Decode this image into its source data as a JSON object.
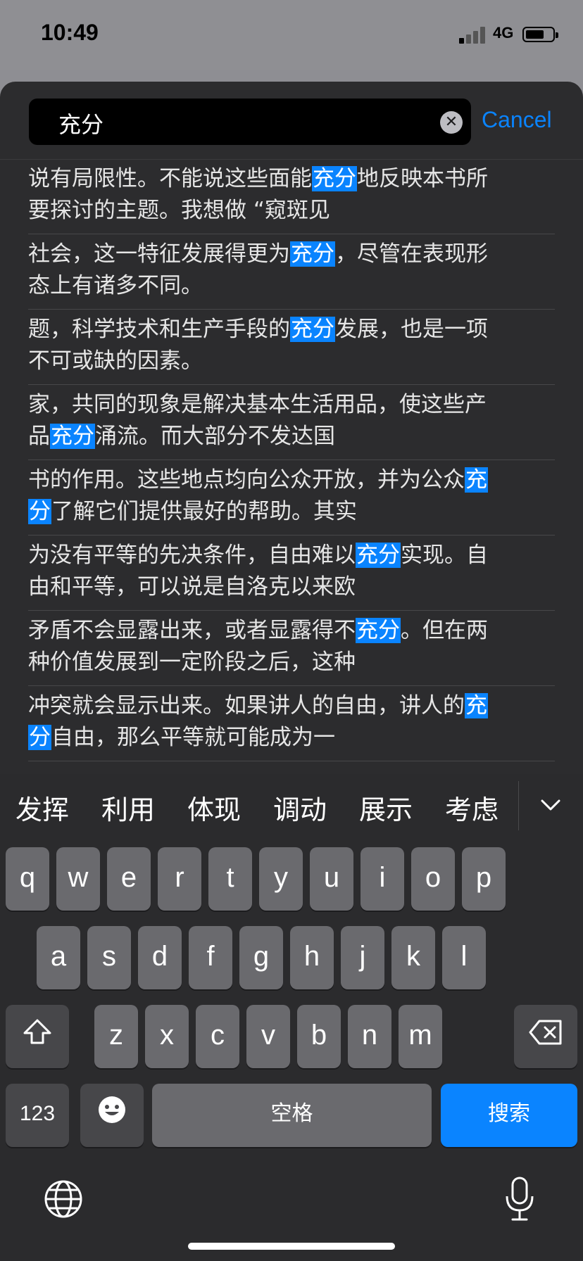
{
  "status": {
    "time": "10:49",
    "network": "4G"
  },
  "search": {
    "query": "充分",
    "cancel_label": "Cancel"
  },
  "results": [
    {
      "lines": [
        [
          [
            "说有局限性。不能说这些面能",
            false
          ],
          [
            "充分",
            true
          ],
          [
            "地反映本书所",
            false
          ]
        ],
        [
          [
            "要探讨的主题。我想做 “窥斑见",
            false
          ]
        ]
      ]
    },
    {
      "lines": [
        [
          [
            "社会，这一特征发展得更为",
            false
          ],
          [
            "充分",
            true
          ],
          [
            "，尽管在表现形",
            false
          ]
        ],
        [
          [
            "态上有诸多不同。",
            false
          ]
        ]
      ]
    },
    {
      "lines": [
        [
          [
            "题，科学技术和生产手段的",
            false
          ],
          [
            "充分",
            true
          ],
          [
            "发展，也是一项",
            false
          ]
        ],
        [
          [
            "不可或缺的因素。",
            false
          ]
        ]
      ]
    },
    {
      "lines": [
        [
          [
            "家，共同的现象是解决基本生活用品，使这些产",
            false
          ]
        ],
        [
          [
            "品",
            false
          ],
          [
            "充分",
            true
          ],
          [
            "涌流。而大部分不发达国",
            false
          ]
        ]
      ]
    },
    {
      "lines": [
        [
          [
            "书的作用。这些地点均向公众开放，并为公众",
            false
          ],
          [
            "充",
            true
          ]
        ],
        [
          [
            "分",
            true
          ],
          [
            "了解它们提供最好的帮助。其实",
            false
          ]
        ]
      ]
    },
    {
      "lines": [
        [
          [
            "为没有平等的先决条件，自由难以",
            false
          ],
          [
            "充分",
            true
          ],
          [
            "实现。自",
            false
          ]
        ],
        [
          [
            "由和平等，可以说是自洛克以来欧",
            false
          ]
        ]
      ]
    },
    {
      "lines": [
        [
          [
            "矛盾不会显露出来，或者显露得不",
            false
          ],
          [
            "充分",
            true
          ],
          [
            "。但在两",
            false
          ]
        ],
        [
          [
            "种价值发展到一定阶段之后，这种",
            false
          ]
        ]
      ]
    },
    {
      "lines": [
        [
          [
            "冲突就会显示出来。如果讲人的自由，讲人的",
            false
          ],
          [
            "充",
            true
          ]
        ],
        [
          [
            "分",
            true
          ],
          [
            "自由，那么平等就可能成为一",
            false
          ]
        ]
      ]
    }
  ],
  "suggestions": [
    "发挥",
    "利用",
    "体现",
    "调动",
    "展示",
    "考虑"
  ],
  "keyboard": {
    "row1": [
      "q",
      "w",
      "e",
      "r",
      "t",
      "y",
      "u",
      "i",
      "o",
      "p"
    ],
    "row2": [
      "a",
      "s",
      "d",
      "f",
      "g",
      "h",
      "j",
      "k",
      "l"
    ],
    "row3": [
      "z",
      "x",
      "c",
      "v",
      "b",
      "n",
      "m"
    ],
    "numbers_label": "123",
    "space_label": "空格",
    "search_label": "搜索"
  },
  "colors": {
    "accent": "#0a84ff",
    "highlight": "#0a84ff",
    "sheet": "#2c2c2e"
  }
}
